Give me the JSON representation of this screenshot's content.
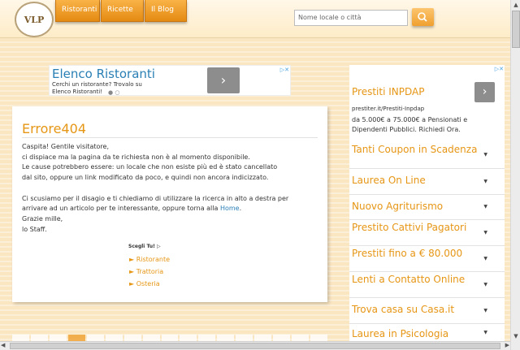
{
  "logo": {
    "text": "VLP"
  },
  "nav": {
    "items": [
      {
        "label": "Ristoranti"
      },
      {
        "label": "Ricette"
      },
      {
        "label": "Il Blog"
      }
    ]
  },
  "search": {
    "placeholder": "Nome locale o città",
    "icon": "search-icon"
  },
  "ad_top": {
    "title": "Elenco Ristoranti",
    "sub_line1": "Cerchi un ristorante? Trovalo su",
    "sub_line2": "Elenco Ristoranti!",
    "arrow": "›",
    "adchoice": "▷✕"
  },
  "main": {
    "title": "Errore404",
    "line1": "Caspita! Gentile visitatore,",
    "line2": "ci dispiace ma la pagina da te richiesta non è al momento disponibile.",
    "line3": "Le cause potrebbero essere: un locale che non esiste più ed è stato cancellato",
    "line4": "dal sito, oppure un link modificato da poco, e quindi non ancora indicizzato.",
    "line5": "Ci scusiamo per il disagio e ti chiediamo di utilizzare la ricerca in alto a destra per",
    "line6a": "arrivare ad un articolo per te interessante, oppure torna alla ",
    "line6link": "Home",
    "line6b": ".",
    "line7": "Grazie mille,",
    "line8": "lo Staff.",
    "scegli": "Scegli Tu! ▷",
    "suggestions": [
      "► Ristorante",
      "► Trattoria",
      "► Osteria"
    ]
  },
  "side_ad": {
    "title": "Prestiti INPDAP",
    "url": "prestiter.it/Prestiti-Inpdap",
    "desc": "da 5.000€ a 75.000€ a Pensionati e Dipendenti Pubblici. Richiedi Ora.",
    "arrow": "›",
    "adchoice": "▷✕"
  },
  "side_items": [
    {
      "label": "Tanti Coupon in Scadenza"
    },
    {
      "label": "Laurea On Line"
    },
    {
      "label": "Nuovo Agriturismo"
    },
    {
      "label": "Prestito Cattivi Pagatori"
    },
    {
      "label": "Prestiti fino a € 80.000"
    },
    {
      "label": "Lenti a Contatto Online"
    },
    {
      "label": "Trova casa su Casa.it"
    },
    {
      "label": "Laurea in Psicologia"
    }
  ],
  "scrollbar": {
    "up": "▲",
    "down": "▼",
    "left": "◀",
    "right": "▶"
  }
}
